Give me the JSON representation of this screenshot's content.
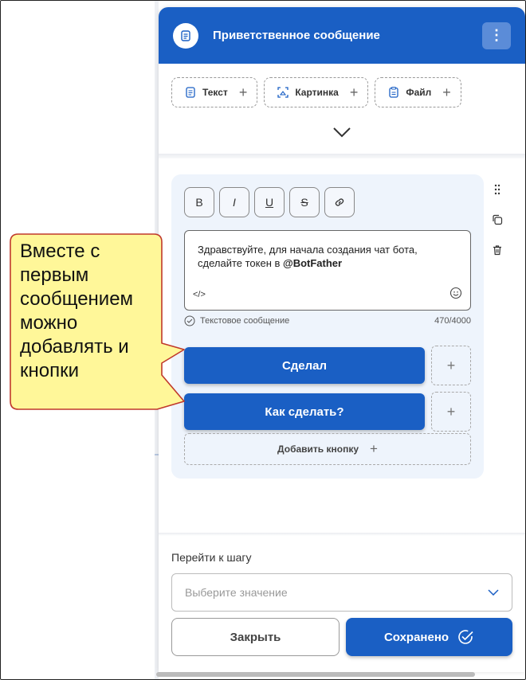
{
  "header": {
    "title": "Приветственное сообщение",
    "menu_icon": "kebab-menu-icon"
  },
  "tools": [
    {
      "label": "Текст",
      "icon": "text-doc-icon"
    },
    {
      "label": "Картинка",
      "icon": "image-scan-icon"
    },
    {
      "label": "Файл",
      "icon": "file-icon"
    }
  ],
  "format_buttons": [
    "B",
    "I",
    "U",
    "S",
    "link"
  ],
  "message": {
    "text_line1": "Здравствуйте, для начала создания чат бота,",
    "text_line2_prefix": "сделайте токен в ",
    "text_line2_bold": "@BotFather",
    "code_label": "</>",
    "type_label": "Текстовое сообщение",
    "counter": "470/4000"
  },
  "reply_buttons": [
    {
      "label": "Сделал"
    },
    {
      "label": "Как сделать?"
    }
  ],
  "add_button_label": "Добавить кнопку",
  "goto": {
    "label": "Перейти к шагу",
    "placeholder": "Выберите значение"
  },
  "footer": {
    "close_label": "Закрыть",
    "save_label": "Сохранено"
  },
  "callout": {
    "text": "Вместе с первым сообщением можно добавлять и кнопки",
    "color": "#fff799",
    "border_color": "#c0392b"
  },
  "colors": {
    "accent": "#1a5fc4"
  }
}
